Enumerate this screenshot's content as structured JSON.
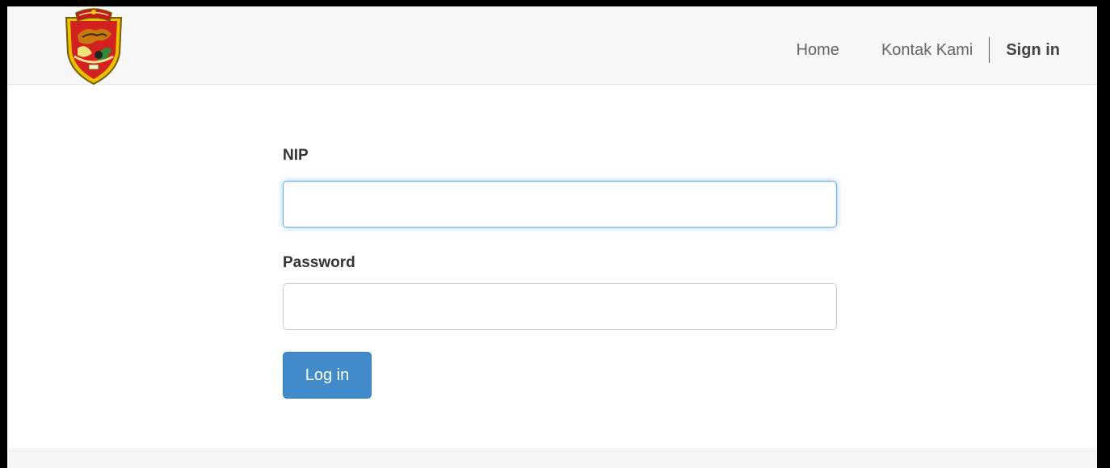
{
  "navbar": {
    "logo_icon": "regional-coat-of-arms-emblem",
    "links": {
      "home": "Home",
      "contact": "Kontak Kami",
      "signin": "Sign in"
    }
  },
  "login_form": {
    "nip_label": "NIP",
    "nip_value": "",
    "password_label": "Password",
    "password_value": "",
    "submit_label": "Log in"
  },
  "colors": {
    "primary_button": "#428bca",
    "focus_border": "#66afe9",
    "navbar_bg": "#f7f7f7"
  }
}
